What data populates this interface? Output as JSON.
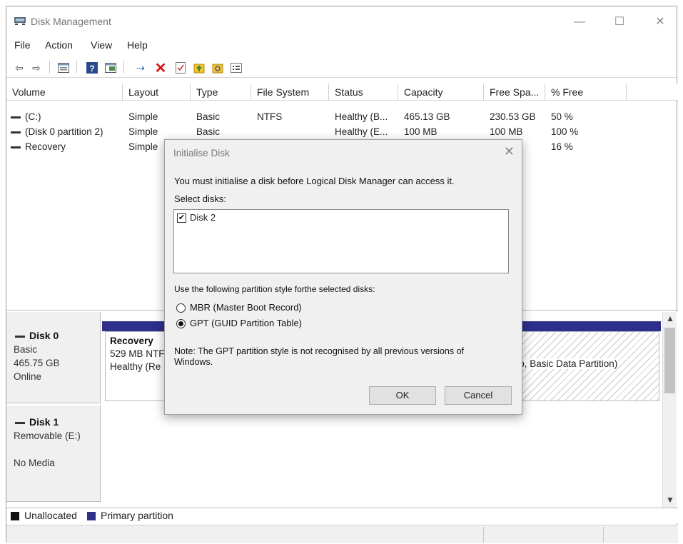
{
  "window": {
    "title": "Disk Management",
    "min": "—",
    "max": "☐",
    "close": "✕"
  },
  "menu": [
    "File",
    "Action",
    "View",
    "Help"
  ],
  "columns": [
    "Volume",
    "Layout",
    "Type",
    "File System",
    "Status",
    "Capacity",
    "Free Spa...",
    "% Free"
  ],
  "volumes": [
    {
      "volume": "(C:)",
      "layout": "Simple",
      "type": "Basic",
      "fs": "NTFS",
      "status": "Healthy (B...",
      "capacity": "465.13 GB",
      "free": "230.53 GB",
      "pct": "50 %"
    },
    {
      "volume": "(Disk 0 partition 2)",
      "layout": "Simple",
      "type": "Basic",
      "fs": "",
      "status": "Healthy (E...",
      "capacity": "100 MB",
      "free": "100 MB",
      "pct": "100 %"
    },
    {
      "volume": "Recovery",
      "layout": "Simple",
      "type": "",
      "fs": "",
      "status": "",
      "capacity": "",
      "free": "",
      "pct": "16 %"
    }
  ],
  "disks": [
    {
      "name": "Disk 0",
      "line1": "Basic",
      "line2": "465.75 GB",
      "line3": "Online"
    },
    {
      "name": "Disk 1",
      "line1": "Removable (E:)",
      "line2": "",
      "line3": "No Media"
    }
  ],
  "partition": {
    "name": "Recovery",
    "size": "529 MB NTF",
    "status": "Healthy (Re",
    "right_label": "mp, Basic Data Partition)"
  },
  "legend": {
    "unallocated": "Unallocated",
    "primary": "Primary partition",
    "unallocated_color": "#111111",
    "primary_color": "#2d2f8a"
  },
  "dialog": {
    "title": "Initialise Disk",
    "message": "You must initialise a disk before Logical Disk Manager can access it.",
    "select_label": "Select disks:",
    "disk_item": "Disk 2",
    "partition_label": "Use the following partition style forthe selected disks:",
    "mbr": "MBR (Master Boot Record)",
    "gpt": "GPT (GUID Partition Table)",
    "note_line1": "Note: The GPT partition style is not recognised by all previous versions of",
    "note_line2": "Windows.",
    "ok": "OK",
    "cancel": "Cancel"
  }
}
